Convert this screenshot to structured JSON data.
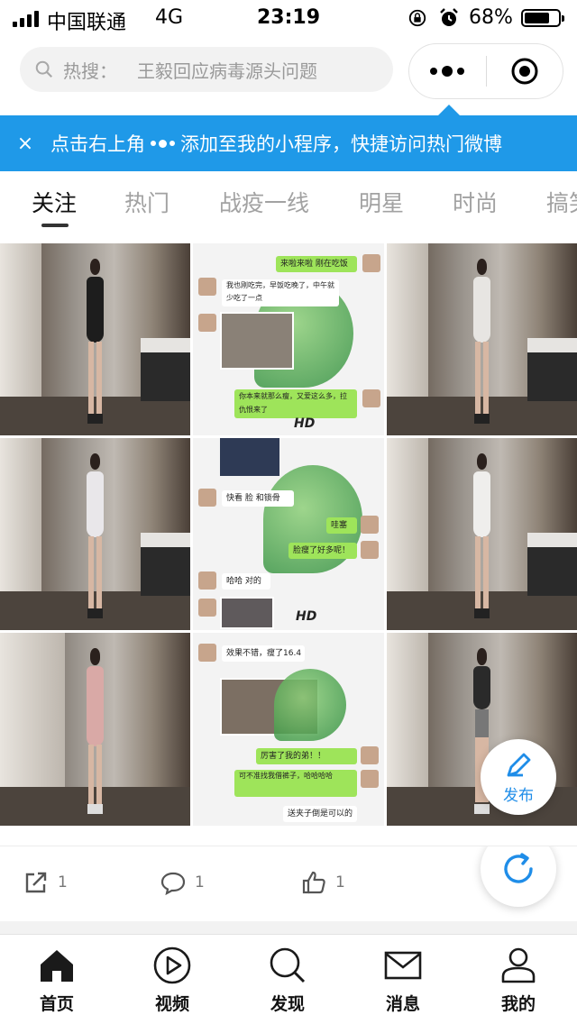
{
  "status_bar": {
    "carrier": "中国联通",
    "network": "4G",
    "time": "23:19",
    "battery": "68%"
  },
  "search": {
    "label": "热搜：",
    "placeholder": "王毅回应病毒源头问题"
  },
  "tip": {
    "close": "×",
    "text_before": "点击右上角",
    "text_after": "添加至我的小程序，快捷访问热门微博"
  },
  "tabs": [
    "关注",
    "热门",
    "战疫一线",
    "明星",
    "时尚",
    "搞笑"
  ],
  "active_tab": "关注",
  "chat_cells": {
    "a": [
      "来啦来啦 刚在吃饭",
      "我也刚吃完，早饭吃晚了，中午就少吃了一点",
      "你本来就那么瘦，又爱这么多，拉仇恨来了"
    ],
    "a_hd": "HD",
    "b": [
      "快看 脸 和锁骨",
      "哇塞",
      "脸瘦了好多呢！",
      "哈哈 对的"
    ],
    "b_hd": "HD",
    "c": [
      "效果不错，瘦了16.4",
      "厉害了我的弟！！",
      "可不准找我借裤子，哈哈哈哈",
      "送夹子倒是可以的"
    ]
  },
  "fab": {
    "publish": "发布"
  },
  "actions": {
    "share_count": "1",
    "comment_count": "1",
    "like_count": "1"
  },
  "nav": [
    "首页",
    "视频",
    "发现",
    "消息",
    "我的"
  ],
  "colors": {
    "accent": "#1f99e8",
    "chat_green": "#9ee45a"
  },
  "icons": {
    "share": "share-icon",
    "comment": "comment-icon",
    "like": "thumbs-up-icon",
    "publish": "pen-icon",
    "refresh": "refresh-icon"
  }
}
